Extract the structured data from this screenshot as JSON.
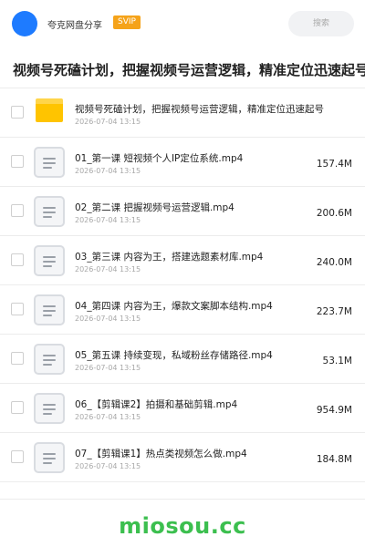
{
  "header": {
    "username": "夸克网盘分享",
    "badge": "SVIP",
    "search_label": "搜索"
  },
  "title": "视频号死磕计划，把握视频号运营逻辑，精准定位迅速起号",
  "files": [
    {
      "type": "folder",
      "name": "视频号死磕计划，把握视频号运营逻辑，精准定位迅速起号",
      "date": "2026-07-04 13:15",
      "size": ""
    },
    {
      "type": "file",
      "name": "01_第一课 短视频个人IP定位系统.mp4",
      "date": "2026-07-04 13:15",
      "size": "157.4M"
    },
    {
      "type": "file",
      "name": "02_第二课 把握视频号运营逻辑.mp4",
      "date": "2026-07-04 13:15",
      "size": "200.6M"
    },
    {
      "type": "file",
      "name": "03_第三课 内容为王，搭建选题素材库.mp4",
      "date": "2026-07-04 13:15",
      "size": "240.0M"
    },
    {
      "type": "file",
      "name": "04_第四课 内容为王，爆款文案脚本结构.mp4",
      "date": "2026-07-04 13:15",
      "size": "223.7M"
    },
    {
      "type": "file",
      "name": "05_第五课 持续变现，私域粉丝存储路径.mp4",
      "date": "2026-07-04 13:15",
      "size": "53.1M"
    },
    {
      "type": "file",
      "name": "06_【剪辑课2】拍摄和基础剪辑.mp4",
      "date": "2026-07-04 13:15",
      "size": "954.9M"
    },
    {
      "type": "file",
      "name": "07_【剪辑课1】热点类视频怎么做.mp4",
      "date": "2026-07-04 13:15",
      "size": "184.8M"
    }
  ],
  "watermark": "miosou.cc",
  "colors": {
    "avatar": "#1e7bff",
    "badge": "#f5a31a",
    "folder": "#ffc400",
    "watermark": "#3cbf4f"
  }
}
